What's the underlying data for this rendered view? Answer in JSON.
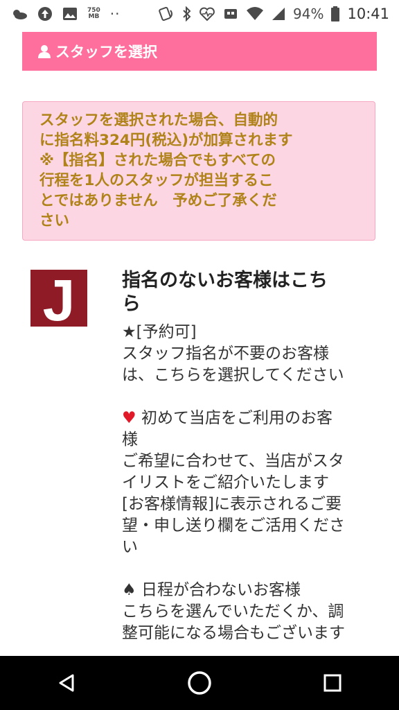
{
  "status_bar": {
    "data_indicator": "750\nMB",
    "data_top": "750",
    "data_bottom": "MB",
    "overflow": "··",
    "battery": "94%",
    "time": "10:41"
  },
  "header": {
    "title": "スタッフを選択",
    "icon": "person-icon"
  },
  "notice": {
    "lines": [
      "スタッフを選択された場合、自動的",
      "に指名料324円(税込)が加算されます",
      "※【指名】された場合でもすべての",
      "行程を1人のスタッフが担当するこ",
      "とではありません　予めご了承くだ",
      "さい"
    ]
  },
  "staff": {
    "logo_letter": "J",
    "name_lines": [
      "指名のないお客様はこち",
      "ら"
    ],
    "desc": {
      "b1": [
        "★[予約可]",
        "スタッフ指名が不要のお客様",
        "は、こちらを選択してください"
      ],
      "b2_first": "初めて当店をご利用のお客",
      "b2": [
        "様",
        "ご希望に合わせて、当店がスタ",
        "イリストをご紹介いたします",
        "[お客様情報]に表示されるご要",
        "望・申し送り欄をご活用くださ",
        "い"
      ],
      "b3_first": "日程が合わないお客様",
      "b3": [
        "こちらを選んでいただくか、調",
        "整可能になる場合もございます"
      ]
    }
  },
  "nav": {
    "back": "back-icon",
    "home": "home-icon",
    "recents": "recents-icon"
  },
  "colors": {
    "header_bg": "#ff6f9e",
    "notice_bg": "#fcd6e2",
    "notice_text": "#b0831a",
    "logo_bg": "#8e1b25",
    "heart": "#e11a2a"
  }
}
